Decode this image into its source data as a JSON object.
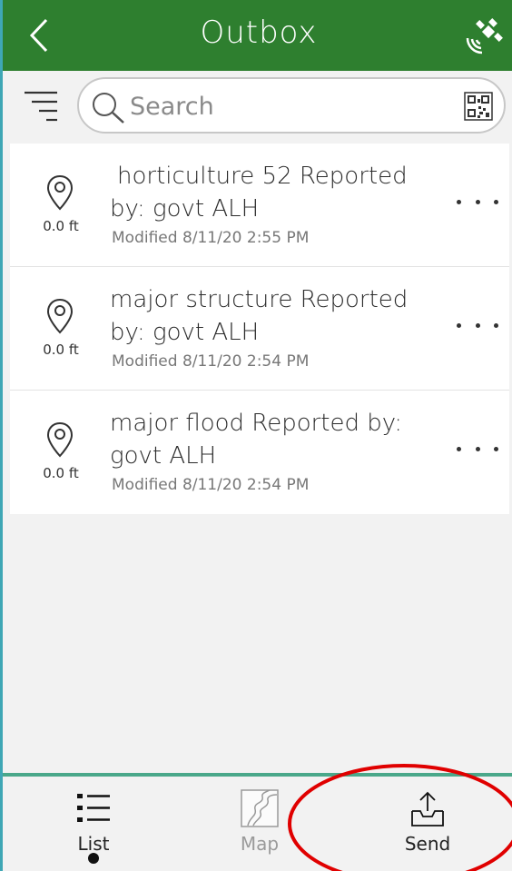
{
  "header": {
    "title": "Outbox",
    "back_icon": "chevron-left-icon",
    "gps_icon": "satellite-signal-icon",
    "color": "#2e7f2f"
  },
  "search": {
    "placeholder": "Search",
    "value": ""
  },
  "items": [
    {
      "title": "horticulture 52 Reported by: govt ALH",
      "distance": "0.0 ft",
      "modified": "Modified 8/11/20 2:55 PM"
    },
    {
      "title": "major structure  Reported by: govt ALH",
      "distance": "0.0 ft",
      "modified": "Modified 8/11/20 2:54 PM"
    },
    {
      "title": "major flood  Reported by: govt ALH",
      "distance": "0.0 ft",
      "modified": "Modified 8/11/20 2:54 PM"
    }
  ],
  "bottom_nav": {
    "list_label": "List",
    "map_label": "Map",
    "send_label": "Send",
    "active": "List"
  },
  "annotation_color": "#e00000"
}
